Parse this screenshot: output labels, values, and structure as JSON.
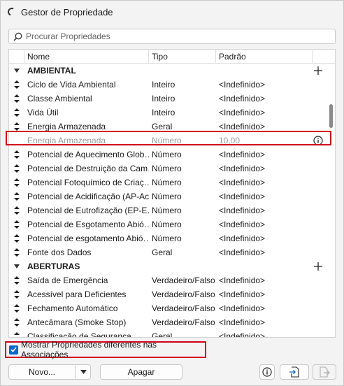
{
  "window": {
    "title": "Gestor de Propriedade"
  },
  "search": {
    "placeholder": "Procurar Propriedades"
  },
  "table": {
    "headers": {
      "name": "Nome",
      "type": "Tipo",
      "default": "Padrão"
    },
    "groups": [
      {
        "label": "AMBIENTAL"
      },
      {
        "label": "ABERTURAS"
      }
    ],
    "rows_ambiental": [
      {
        "name": "Ciclo de Vida Ambiental",
        "type": "Inteiro",
        "default": "<Indefinido>"
      },
      {
        "name": "Classe Ambiental",
        "type": "Inteiro",
        "default": "<Indefinido>"
      },
      {
        "name": "Vida Útil",
        "type": "Inteiro",
        "default": "<Indefinido>"
      },
      {
        "name": "Energia Armazenada",
        "type": "Geral",
        "default": "<Indefinido>"
      },
      {
        "name": "Energia Armazenada",
        "type": "Número",
        "default": "10,00"
      },
      {
        "name": "Potencial de Aquecimento Glob…",
        "type": "Número",
        "default": "<Indefinido>"
      },
      {
        "name": "Potencial de Destruição da Cam…",
        "type": "Número",
        "default": "<Indefinido>"
      },
      {
        "name": "Potencial Fotoquímico de Criaç…",
        "type": "Número",
        "default": "<Indefinido>"
      },
      {
        "name": "Potencial de Acidificação (AP-Ac…",
        "type": "Número",
        "default": "<Indefinido>"
      },
      {
        "name": "Potencial de Eutrofização (EP-E…",
        "type": "Número",
        "default": "<Indefinido>"
      },
      {
        "name": "Potencial de Esgotamento Abió…",
        "type": "Número",
        "default": "<Indefinido>"
      },
      {
        "name": "Potencial de esgotamento Abió…",
        "type": "Número",
        "default": "<Indefinido>"
      },
      {
        "name": "Fonte dos Dados",
        "type": "Geral",
        "default": "<Indefinido>"
      }
    ],
    "rows_aberturas": [
      {
        "name": "Saída de Emergência",
        "type": "Verdadeiro/Falso",
        "default": "<Indefinido>"
      },
      {
        "name": "Acessível para Deficientes",
        "type": "Verdadeiro/Falso",
        "default": "<Indefinido>"
      },
      {
        "name": "Fechamento Automático",
        "type": "Verdadeiro/Falso",
        "default": "<Indefinido>"
      },
      {
        "name": "Antecâmara (Smoke Stop)",
        "type": "Verdadeiro/Falso",
        "default": "<Indefinido>"
      },
      {
        "name": "Classificação de Segurança",
        "type": "Geral",
        "default": "<Indefinido>"
      }
    ]
  },
  "footer": {
    "checkbox_label": "Mostrar Propriedades diferentes nas Associações",
    "new_label": "Novo...",
    "delete_label": "Apagar"
  },
  "colors": {
    "accent": "#0b66c6",
    "highlight": "#d0021b"
  }
}
